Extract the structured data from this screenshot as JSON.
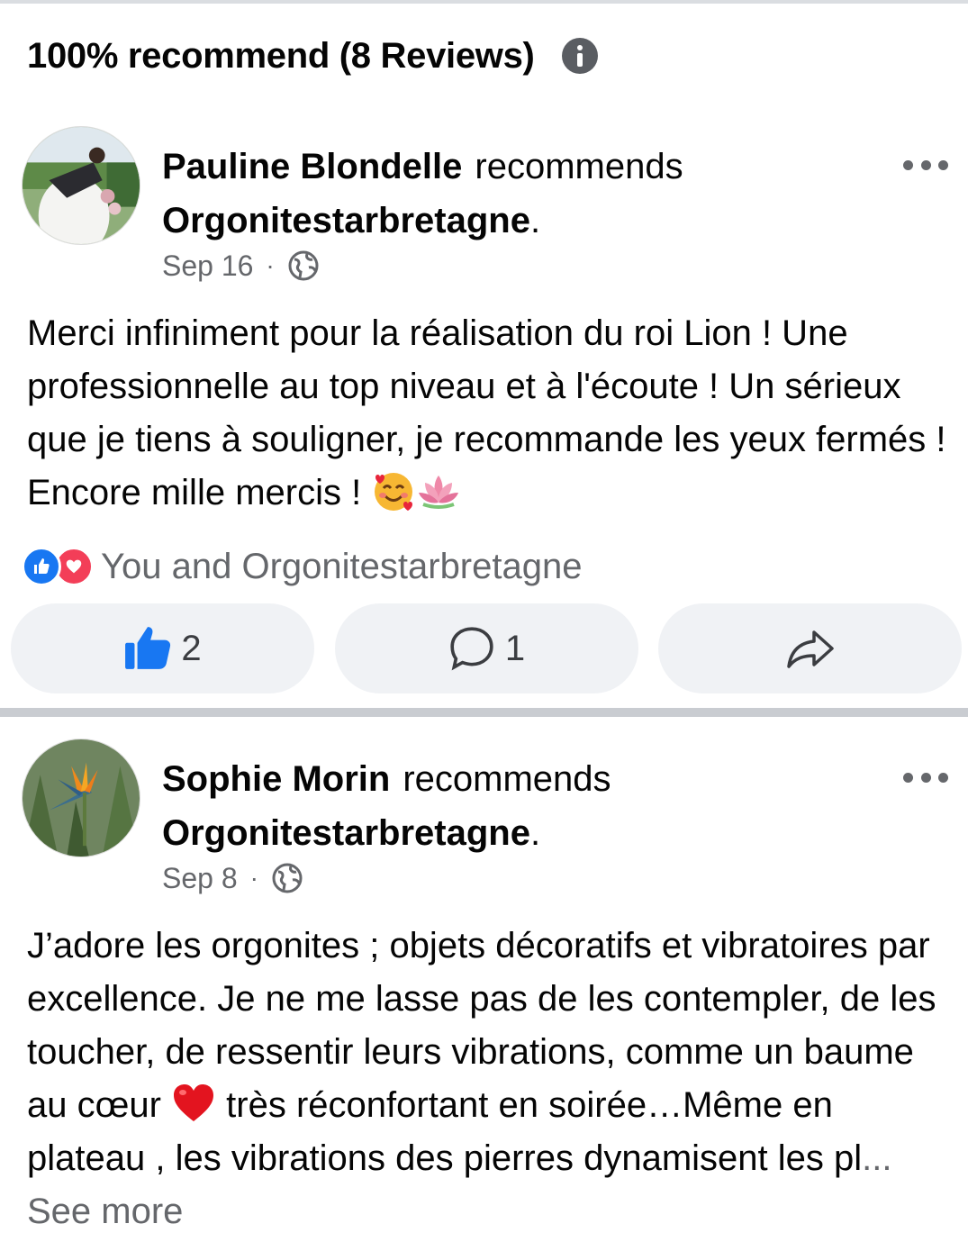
{
  "header": {
    "title": "100% recommend (8 Reviews)",
    "info_icon": "info-icon"
  },
  "reviews": [
    {
      "author": "Pauline Blondelle",
      "verb": "recommends",
      "page": "Orgonitestarbretagne",
      "page_suffix": ".",
      "date": "Sep 16",
      "separator": "·",
      "privacy_icon": "globe-icon",
      "text": "Merci infiniment pour la réalisation du roi Lion ! Une professionnelle au top niveau et à l'écoute ! Un sérieux que je tiens à souligner, je recommande les yeux fermés ! Encore mille mercis ! ",
      "emojis": [
        "smiling-face-with-hearts-emoji",
        "lotus-emoji"
      ],
      "reactions": {
        "icons": [
          "like-reaction-icon",
          "love-reaction-icon"
        ],
        "label": "You and Orgonitestarbretagne"
      },
      "actions": {
        "like_count": "2",
        "comment_count": "1"
      }
    },
    {
      "author": "Sophie Morin",
      "verb": "recommends",
      "page": "Orgonitestarbretagne",
      "page_suffix": ".",
      "date": "Sep 8",
      "separator": "·",
      "privacy_icon": "globe-icon",
      "text_before_emoji": "J’adore les orgonites ; objets décoratifs et vibratoires par excellence. Je ne me lasse pas de les contempler, de les toucher, de ressentir leurs vibrations, comme un baume au cœur ",
      "emoji": "red-heart-emoji",
      "text_after_emoji": " très réconfortant en soirée…Même en plateau , les vibrations des pierres dynamisent les pl",
      "ellipsis": "...",
      "see_more": "See more"
    }
  ],
  "colors": {
    "accent_blue": "#1877f2",
    "love_red": "#f33e58",
    "secondary_text": "#65676b",
    "button_bg": "#f0f2f5",
    "divider": "#c9ccd1"
  }
}
